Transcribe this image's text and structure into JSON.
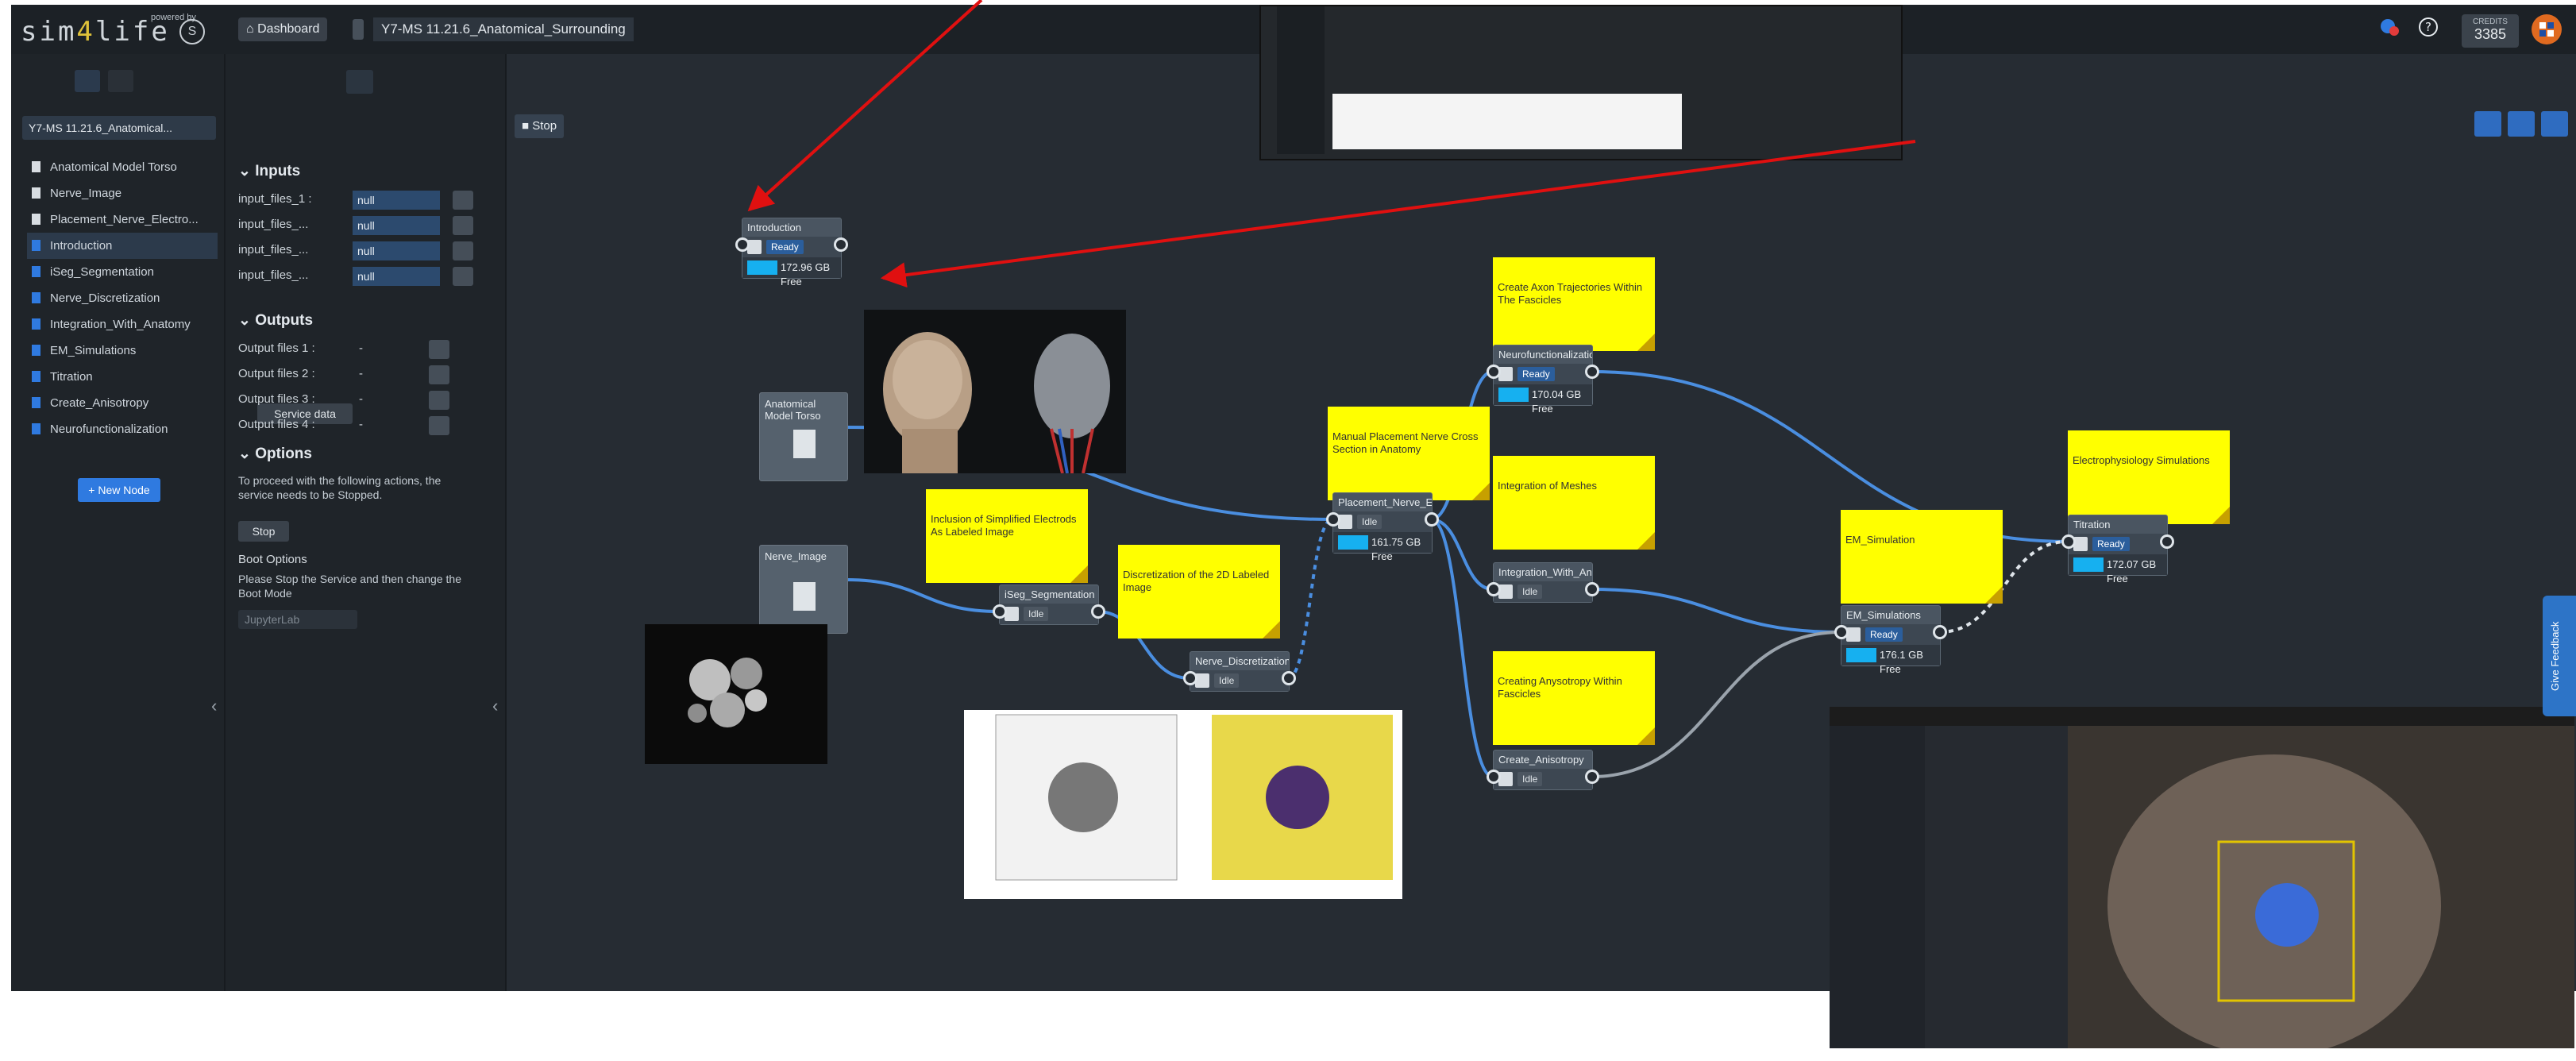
{
  "header": {
    "logo": "sim4life",
    "powered_by": "powered by",
    "dashboard_label": "Dashboard",
    "study_title": "Y7-MS 11.21.6_Anatomical_Surrounding",
    "credits_label": "CREDITS",
    "credits_value": "3385"
  },
  "sidebar": {
    "study_chip": "Y7-MS 11.21.6_Anatomical...",
    "items": [
      {
        "label": "Anatomical Model Torso",
        "type": "file"
      },
      {
        "label": "Nerve_Image",
        "type": "file"
      },
      {
        "label": "Placement_Nerve_Electro...",
        "type": "file"
      },
      {
        "label": "Introduction",
        "type": "service"
      },
      {
        "label": "iSeg_Segmentation",
        "type": "service"
      },
      {
        "label": "Nerve_Discretization",
        "type": "service"
      },
      {
        "label": "Integration_With_Anatomy",
        "type": "service"
      },
      {
        "label": "EM_Simulations",
        "type": "service"
      },
      {
        "label": "Titration",
        "type": "service"
      },
      {
        "label": "Create_Anisotropy",
        "type": "service"
      },
      {
        "label": "Neurofunctionalization",
        "type": "service"
      }
    ],
    "selected_index": 3,
    "new_node_label": "+ New Node"
  },
  "panel": {
    "inputs_title": "Inputs",
    "inputs": [
      {
        "label": "input_files_1 :",
        "value": "null"
      },
      {
        "label": "input_files_...",
        "value": "null"
      },
      {
        "label": "input_files_...",
        "value": "null"
      },
      {
        "label": "input_files_...",
        "value": "null"
      }
    ],
    "outputs_title": "Outputs",
    "outputs": [
      {
        "label": "Output files 1 :",
        "value": "-"
      },
      {
        "label": "Output files 2 :",
        "value": "-"
      },
      {
        "label": "Output files 3 :",
        "value": "-"
      },
      {
        "label": "Output files 4 :",
        "value": "-"
      }
    ],
    "service_data_label": "Service data",
    "options_title": "Options",
    "stop_warning": "To proceed with the following actions, the service needs to be Stopped.",
    "stop_label": "Stop",
    "boot_title": "Boot Options",
    "boot_text": "Please Stop the Service and then change the Boot Mode",
    "boot_value": "JupyterLab"
  },
  "canvas": {
    "stop_label": "Stop",
    "file_nodes": [
      {
        "title": "Anatomical Model Torso"
      },
      {
        "title": "Nerve_Image"
      }
    ],
    "nodes": [
      {
        "title": "Introduction",
        "status": "Ready",
        "free": "172.96 GB Free"
      },
      {
        "title": "iSeg_Segmentation",
        "status": "Idle"
      },
      {
        "title": "Nerve_Discretization",
        "status": "Idle"
      },
      {
        "title": "Placement_Nerve_Elec...",
        "status": "Idle",
        "free": "161.75 GB Free"
      },
      {
        "title": "Neurofunctionalization",
        "status": "Ready",
        "free": "170.04 GB Free"
      },
      {
        "title": "Integration_With_Anat...",
        "status": "Idle"
      },
      {
        "title": "Create_Anisotropy",
        "status": "Idle"
      },
      {
        "title": "EM_Simulations",
        "status": "Ready",
        "free": "176.1 GB Free"
      },
      {
        "title": "Titration",
        "status": "Ready",
        "free": "172.07 GB Free"
      }
    ],
    "stickies": [
      "Create Axon Trajectories Within The Fascicles",
      "Integration of Meshes",
      "Creating Anysotropy Within Fascicles",
      "Manual Placement Nerve Cross Section in Anatomy",
      "Inclusion of Simplified Electrods As Labeled Image",
      "Discretization of the 2D Labeled Image",
      "EM_Simulation",
      "Electrophysiology Simulations"
    ]
  },
  "feedback_label": "Give Feedback",
  "colors": {
    "sticky": "#ffff00",
    "accent": "#2f7ae0",
    "annotation_arrow": "#e01010",
    "edge": "#4a8ee0"
  }
}
